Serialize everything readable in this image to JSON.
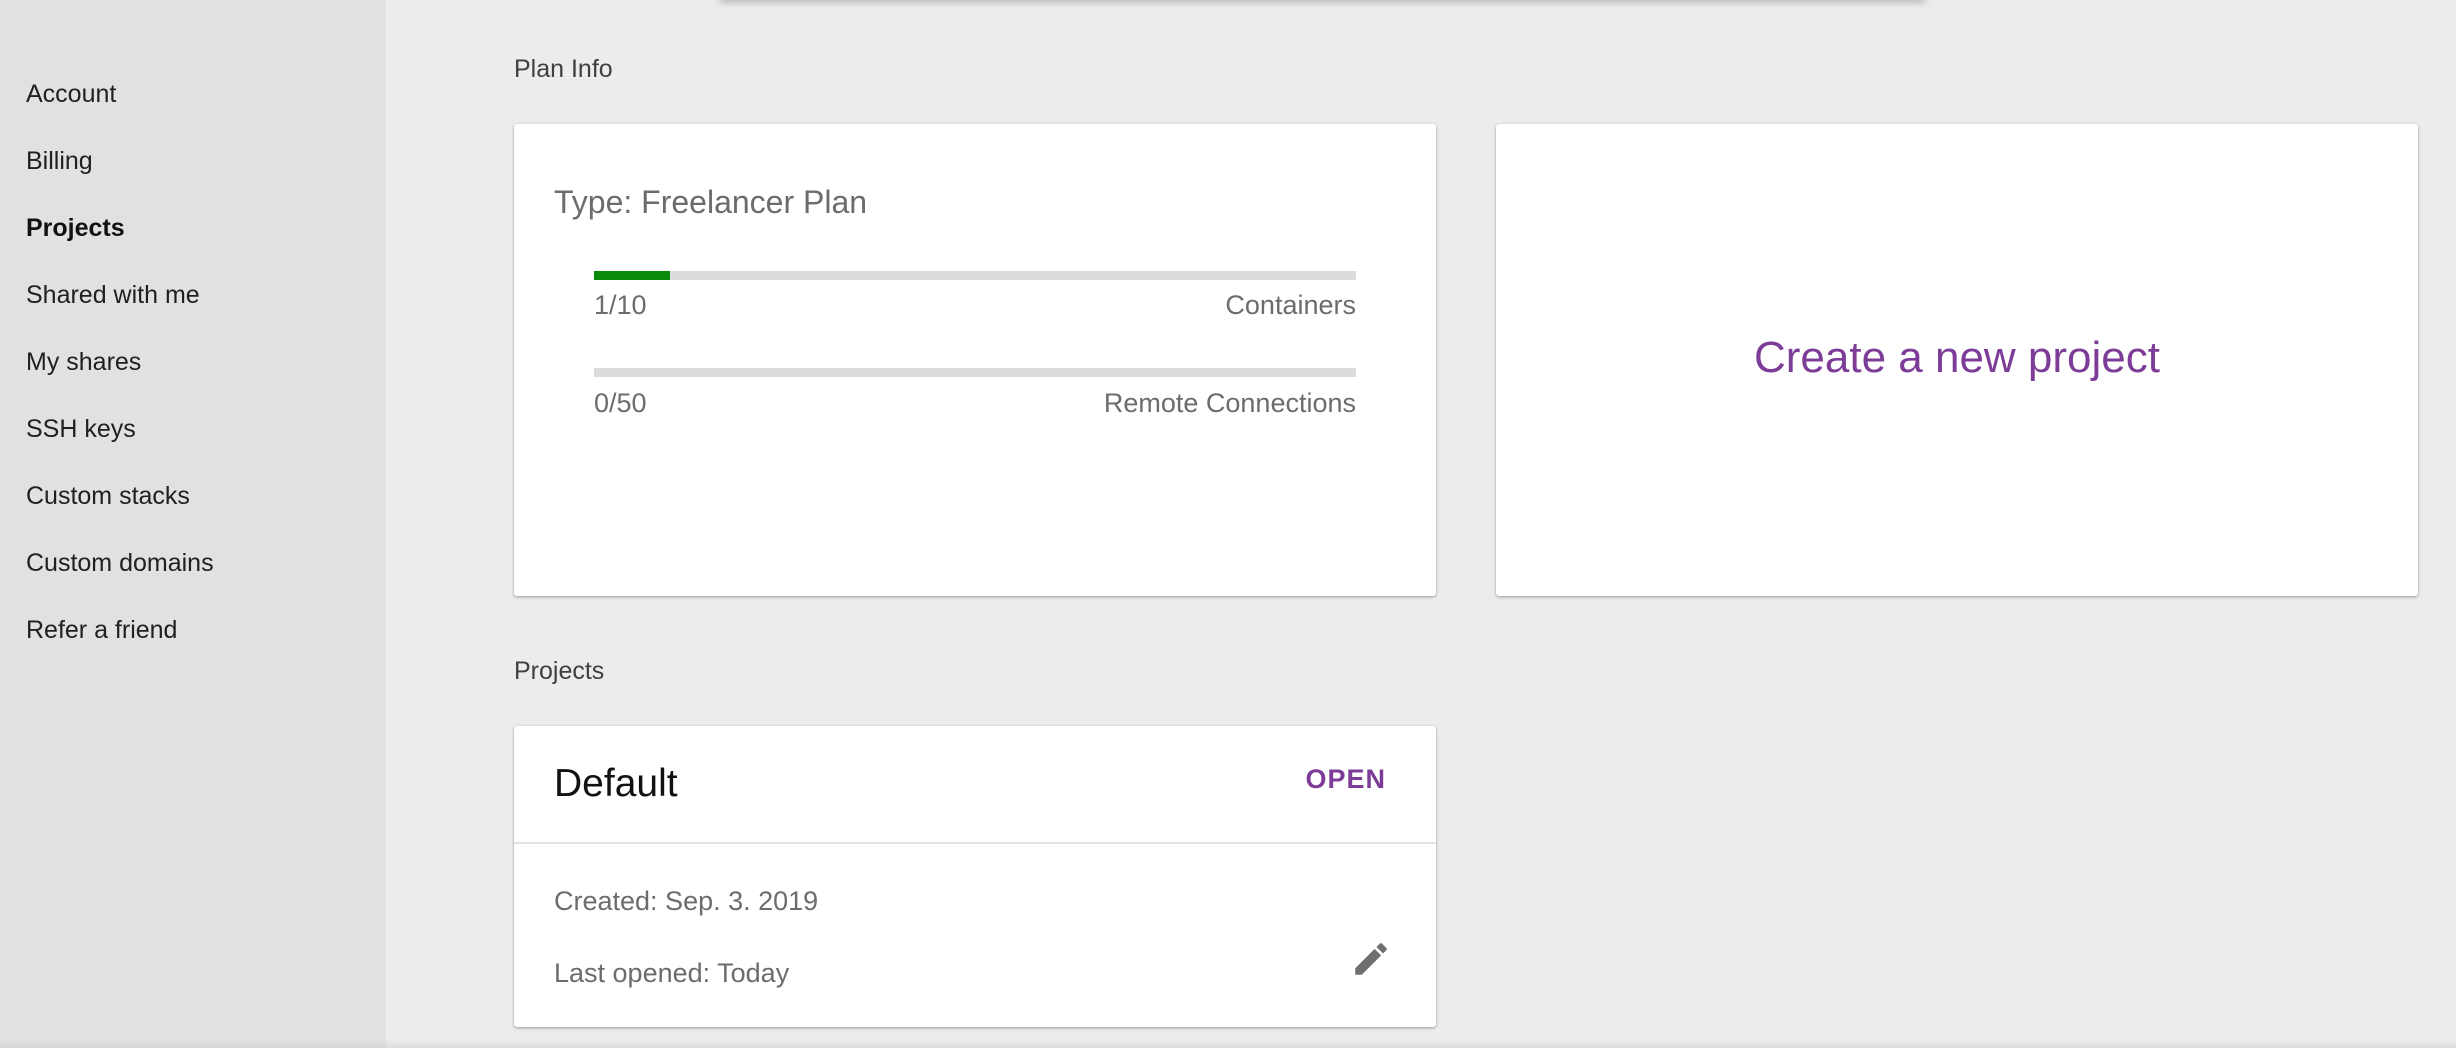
{
  "sidebar": {
    "items": [
      {
        "label": "Account"
      },
      {
        "label": "Billing"
      },
      {
        "label": "Projects"
      },
      {
        "label": "Shared with me"
      },
      {
        "label": "My shares"
      },
      {
        "label": "SSH keys"
      },
      {
        "label": "Custom stacks"
      },
      {
        "label": "Custom domains"
      },
      {
        "label": "Refer a friend"
      }
    ],
    "active": "Projects"
  },
  "plan_info": {
    "section_title": "Plan Info",
    "type_label": "Type: Freelancer Plan",
    "containers": {
      "count_text": "1/10",
      "label": "Containers",
      "used": 1,
      "limit": 10
    },
    "remote_connections": {
      "count_text": "0/50",
      "label": "Remote Connections",
      "used": 0,
      "limit": 50
    },
    "bar_color": "#0a8a0a"
  },
  "create_project": {
    "label": "Create a new project",
    "color": "#7d3c98"
  },
  "projects": {
    "section_title": "Projects",
    "items": [
      {
        "name": "Default",
        "open_label": "OPEN",
        "created": "Created: Sep. 3. 2019",
        "last_opened": "Last opened: Today",
        "icon": "pencil-icon"
      }
    ]
  }
}
